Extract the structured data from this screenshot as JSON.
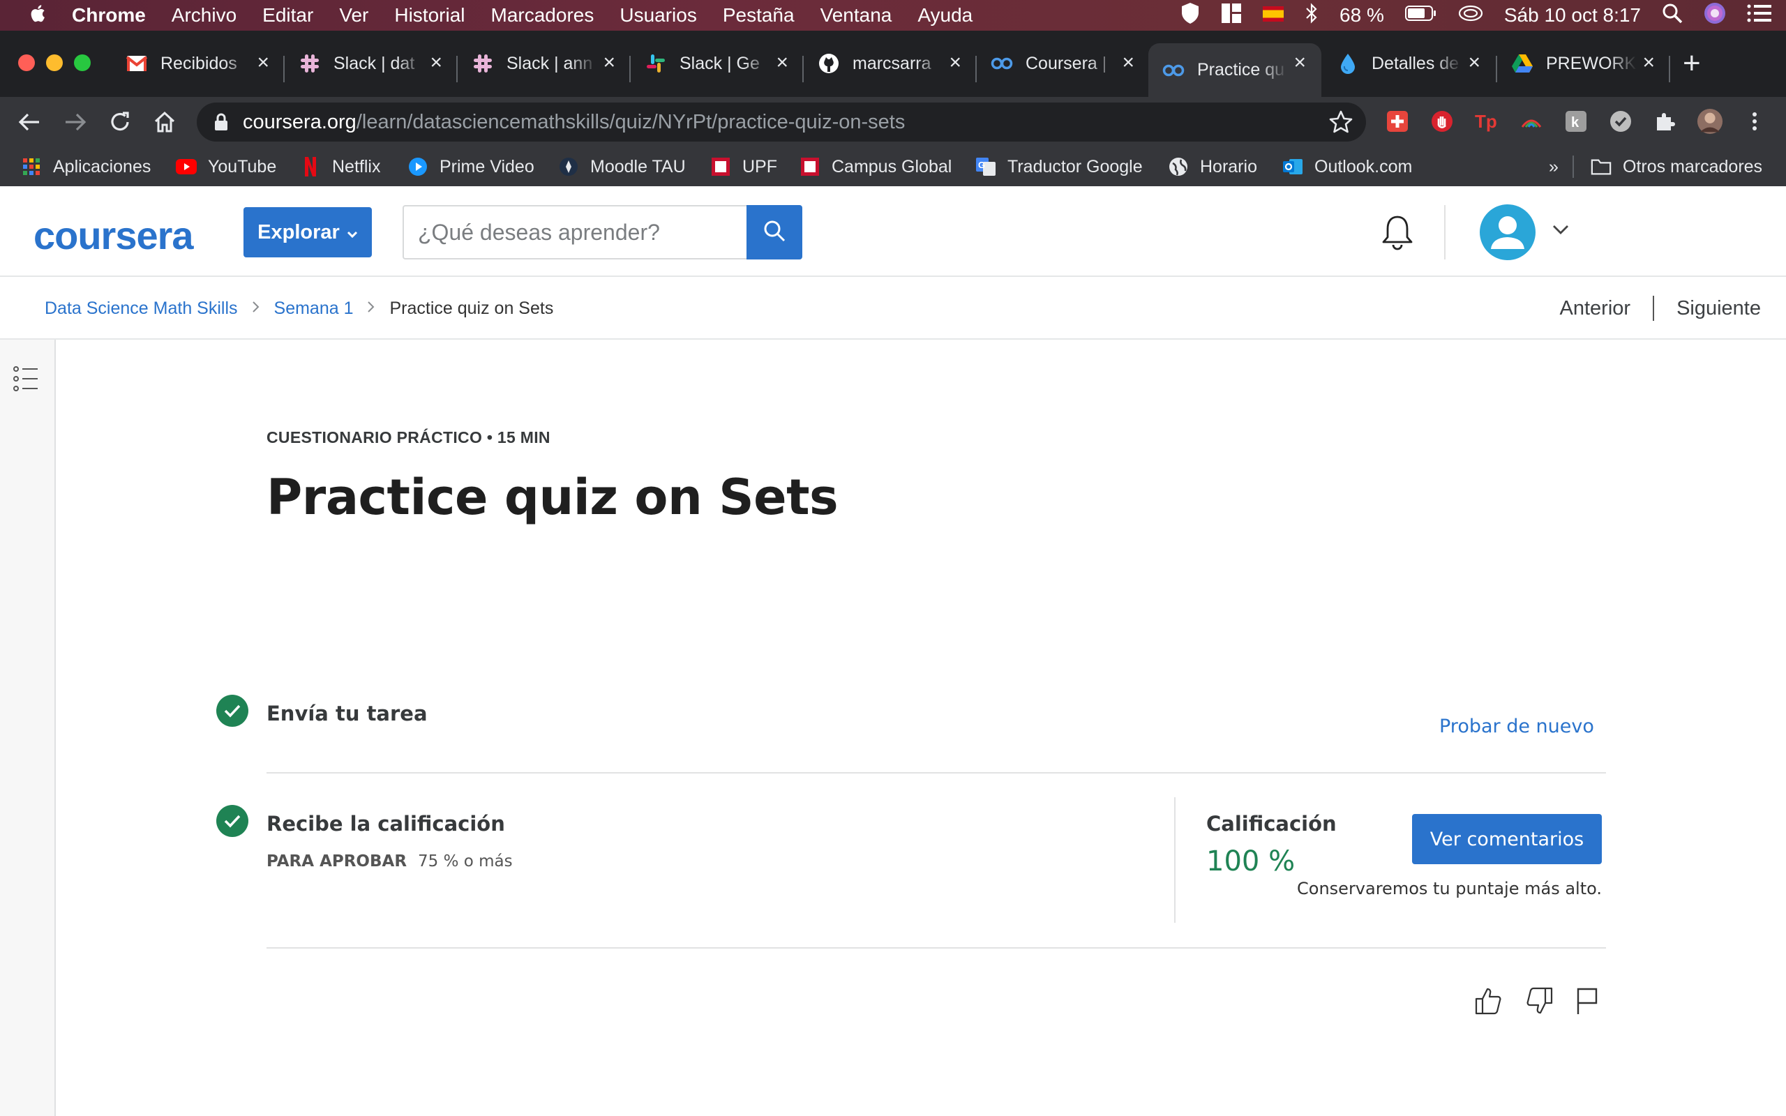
{
  "menubar": {
    "app": "Chrome",
    "items": [
      "Archivo",
      "Editar",
      "Ver",
      "Historial",
      "Marcadores",
      "Usuarios",
      "Pestaña",
      "Ventana",
      "Ayuda"
    ],
    "battery": "68 %",
    "datetime": "Sáb 10 oct  8:17"
  },
  "tabs": [
    {
      "title": "Recibidos",
      "icon": "gmail-icon"
    },
    {
      "title": "Slack | dat",
      "icon": "slack-icon"
    },
    {
      "title": "Slack | ann",
      "icon": "slack-icon"
    },
    {
      "title": "Slack | Ge",
      "icon": "slack-color-icon"
    },
    {
      "title": "marcsarra",
      "icon": "github-icon"
    },
    {
      "title": "Coursera |",
      "icon": "coursera-icon"
    },
    {
      "title": "Practice qu",
      "icon": "coursera-icon",
      "active": true
    },
    {
      "title": "Detalles de",
      "icon": "drop-icon"
    },
    {
      "title": "PREWORK",
      "icon": "drive-icon"
    }
  ],
  "omnibox": {
    "domain": "coursera.org",
    "path": "/learn/datasciencemathskills/quiz/NYrPt/practice-quiz-on-sets"
  },
  "bookmarks": {
    "items": [
      "Aplicaciones",
      "YouTube",
      "Netflix",
      "Prime Video",
      "Moodle TAU",
      "UPF",
      "Campus Global",
      "Traductor Google",
      "Horario",
      "Outlook.com"
    ],
    "overflow": "»",
    "other": "Otros marcadores"
  },
  "header": {
    "logo": "coursera",
    "explore_label": "Explorar",
    "search_placeholder": "¿Qué deseas aprender?"
  },
  "breadcrumb": {
    "course": "Data Science Math Skills",
    "week": "Semana 1",
    "current": "Practice quiz on Sets",
    "prev": "Anterior",
    "next": "Siguiente"
  },
  "quiz": {
    "eyebrow": "CUESTIONARIO PRÁCTICO • 15 MIN",
    "title": "Practice quiz on Sets",
    "step1_title": "Envía tu tarea",
    "retry_label": "Probar de nuevo",
    "step2_title": "Recibe la calificación",
    "pass_label": "PARA APROBAR",
    "pass_value": "75 % o más",
    "grade_label": "Calificación",
    "grade_value": "100 %",
    "feedback_button": "Ver comentarios",
    "keep_note": "Conservaremos tu puntaje más alto."
  },
  "colors": {
    "brand": "#2a73cc",
    "success": "#1f8354"
  }
}
